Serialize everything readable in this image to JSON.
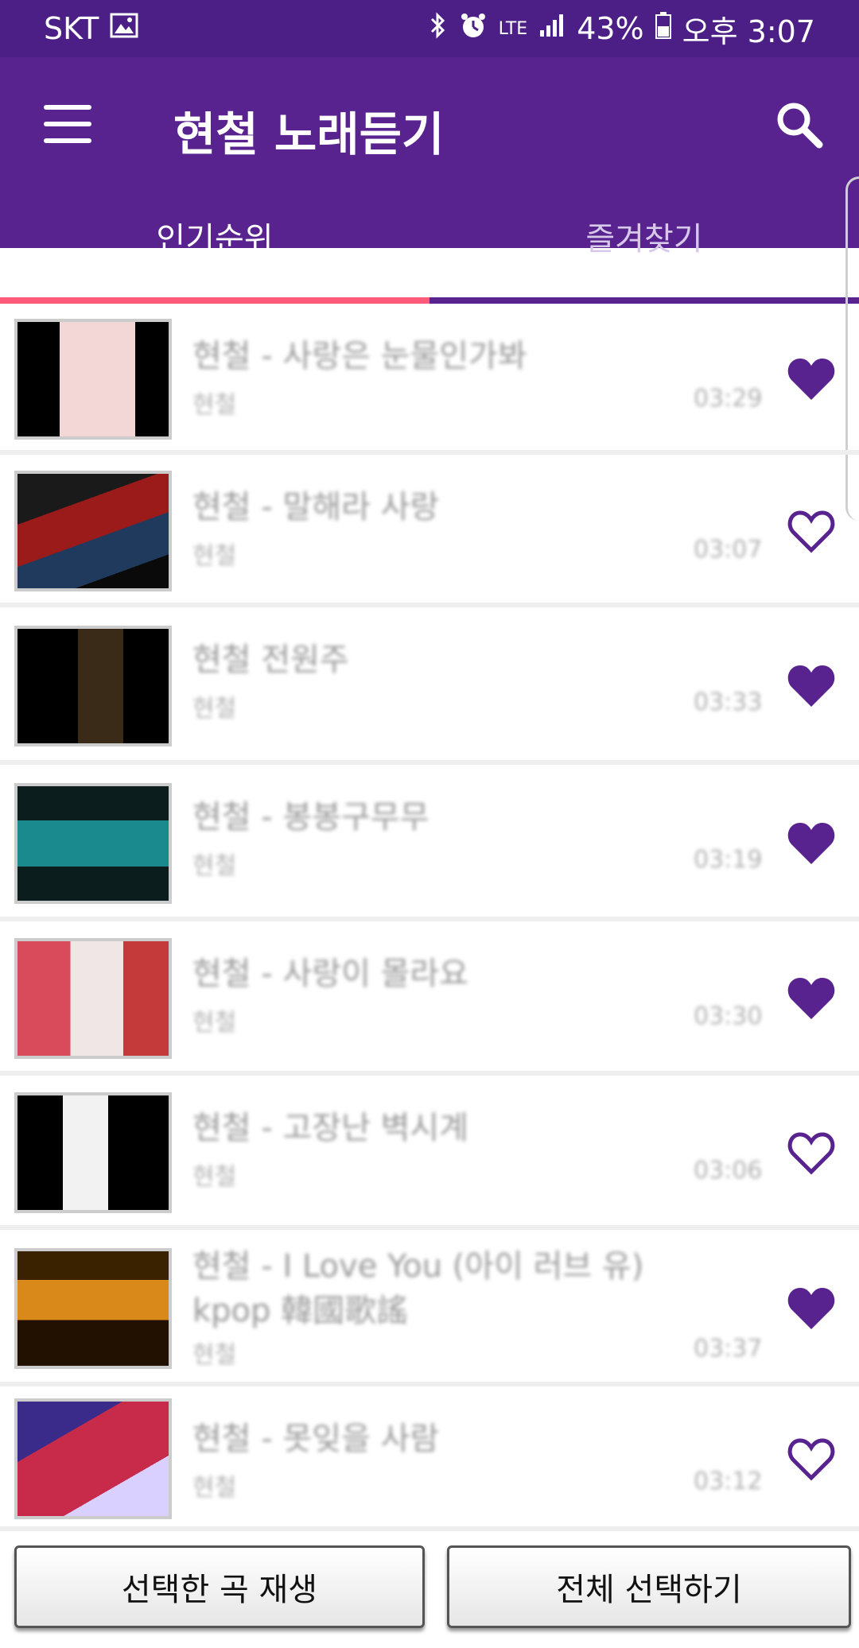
{
  "status_bar": {
    "carrier": "SKT",
    "network": "LTE",
    "battery": "43%",
    "time": "오후 3:07"
  },
  "app_bar": {
    "title": "현철 노래듣기"
  },
  "tabs": [
    {
      "label": "인기순위",
      "active": true
    },
    {
      "label": "즐겨찾기",
      "active": false
    }
  ],
  "songs": [
    {
      "title": "현철 - 사랑은 눈물인가봐",
      "artist": "현철",
      "duration": "03:29",
      "favorite": true
    },
    {
      "title": "현철 - 말해라 사랑",
      "artist": "현철",
      "duration": "03:07",
      "favorite": false
    },
    {
      "title": "현철 전원주",
      "artist": "현철",
      "duration": "03:33",
      "favorite": true
    },
    {
      "title": "현철 - 봉봉구무무",
      "artist": "현철",
      "duration": "03:19",
      "favorite": true
    },
    {
      "title": "현철 - 사랑이 몰라요",
      "artist": "현철",
      "duration": "03:30",
      "favorite": true
    },
    {
      "title": "현철 - 고장난 벽시계",
      "artist": "현철",
      "duration": "03:06",
      "favorite": false
    },
    {
      "title": "현철 - I Love You (아이 러브 유) kpop 韓國歌謠",
      "artist": "현철",
      "duration": "03:37",
      "favorite": true
    },
    {
      "title": "현철 - 못잊을 사람",
      "artist": "현철",
      "duration": "03:12",
      "favorite": false
    }
  ],
  "buttons": {
    "play_selected": "선택한 곡 재생",
    "select_all": "전체 선택하기"
  },
  "colors": {
    "primary": "#58238f",
    "status_bar": "#4b1f86",
    "tab_indicator": "#ff5a7a",
    "heart": "#58238f"
  }
}
